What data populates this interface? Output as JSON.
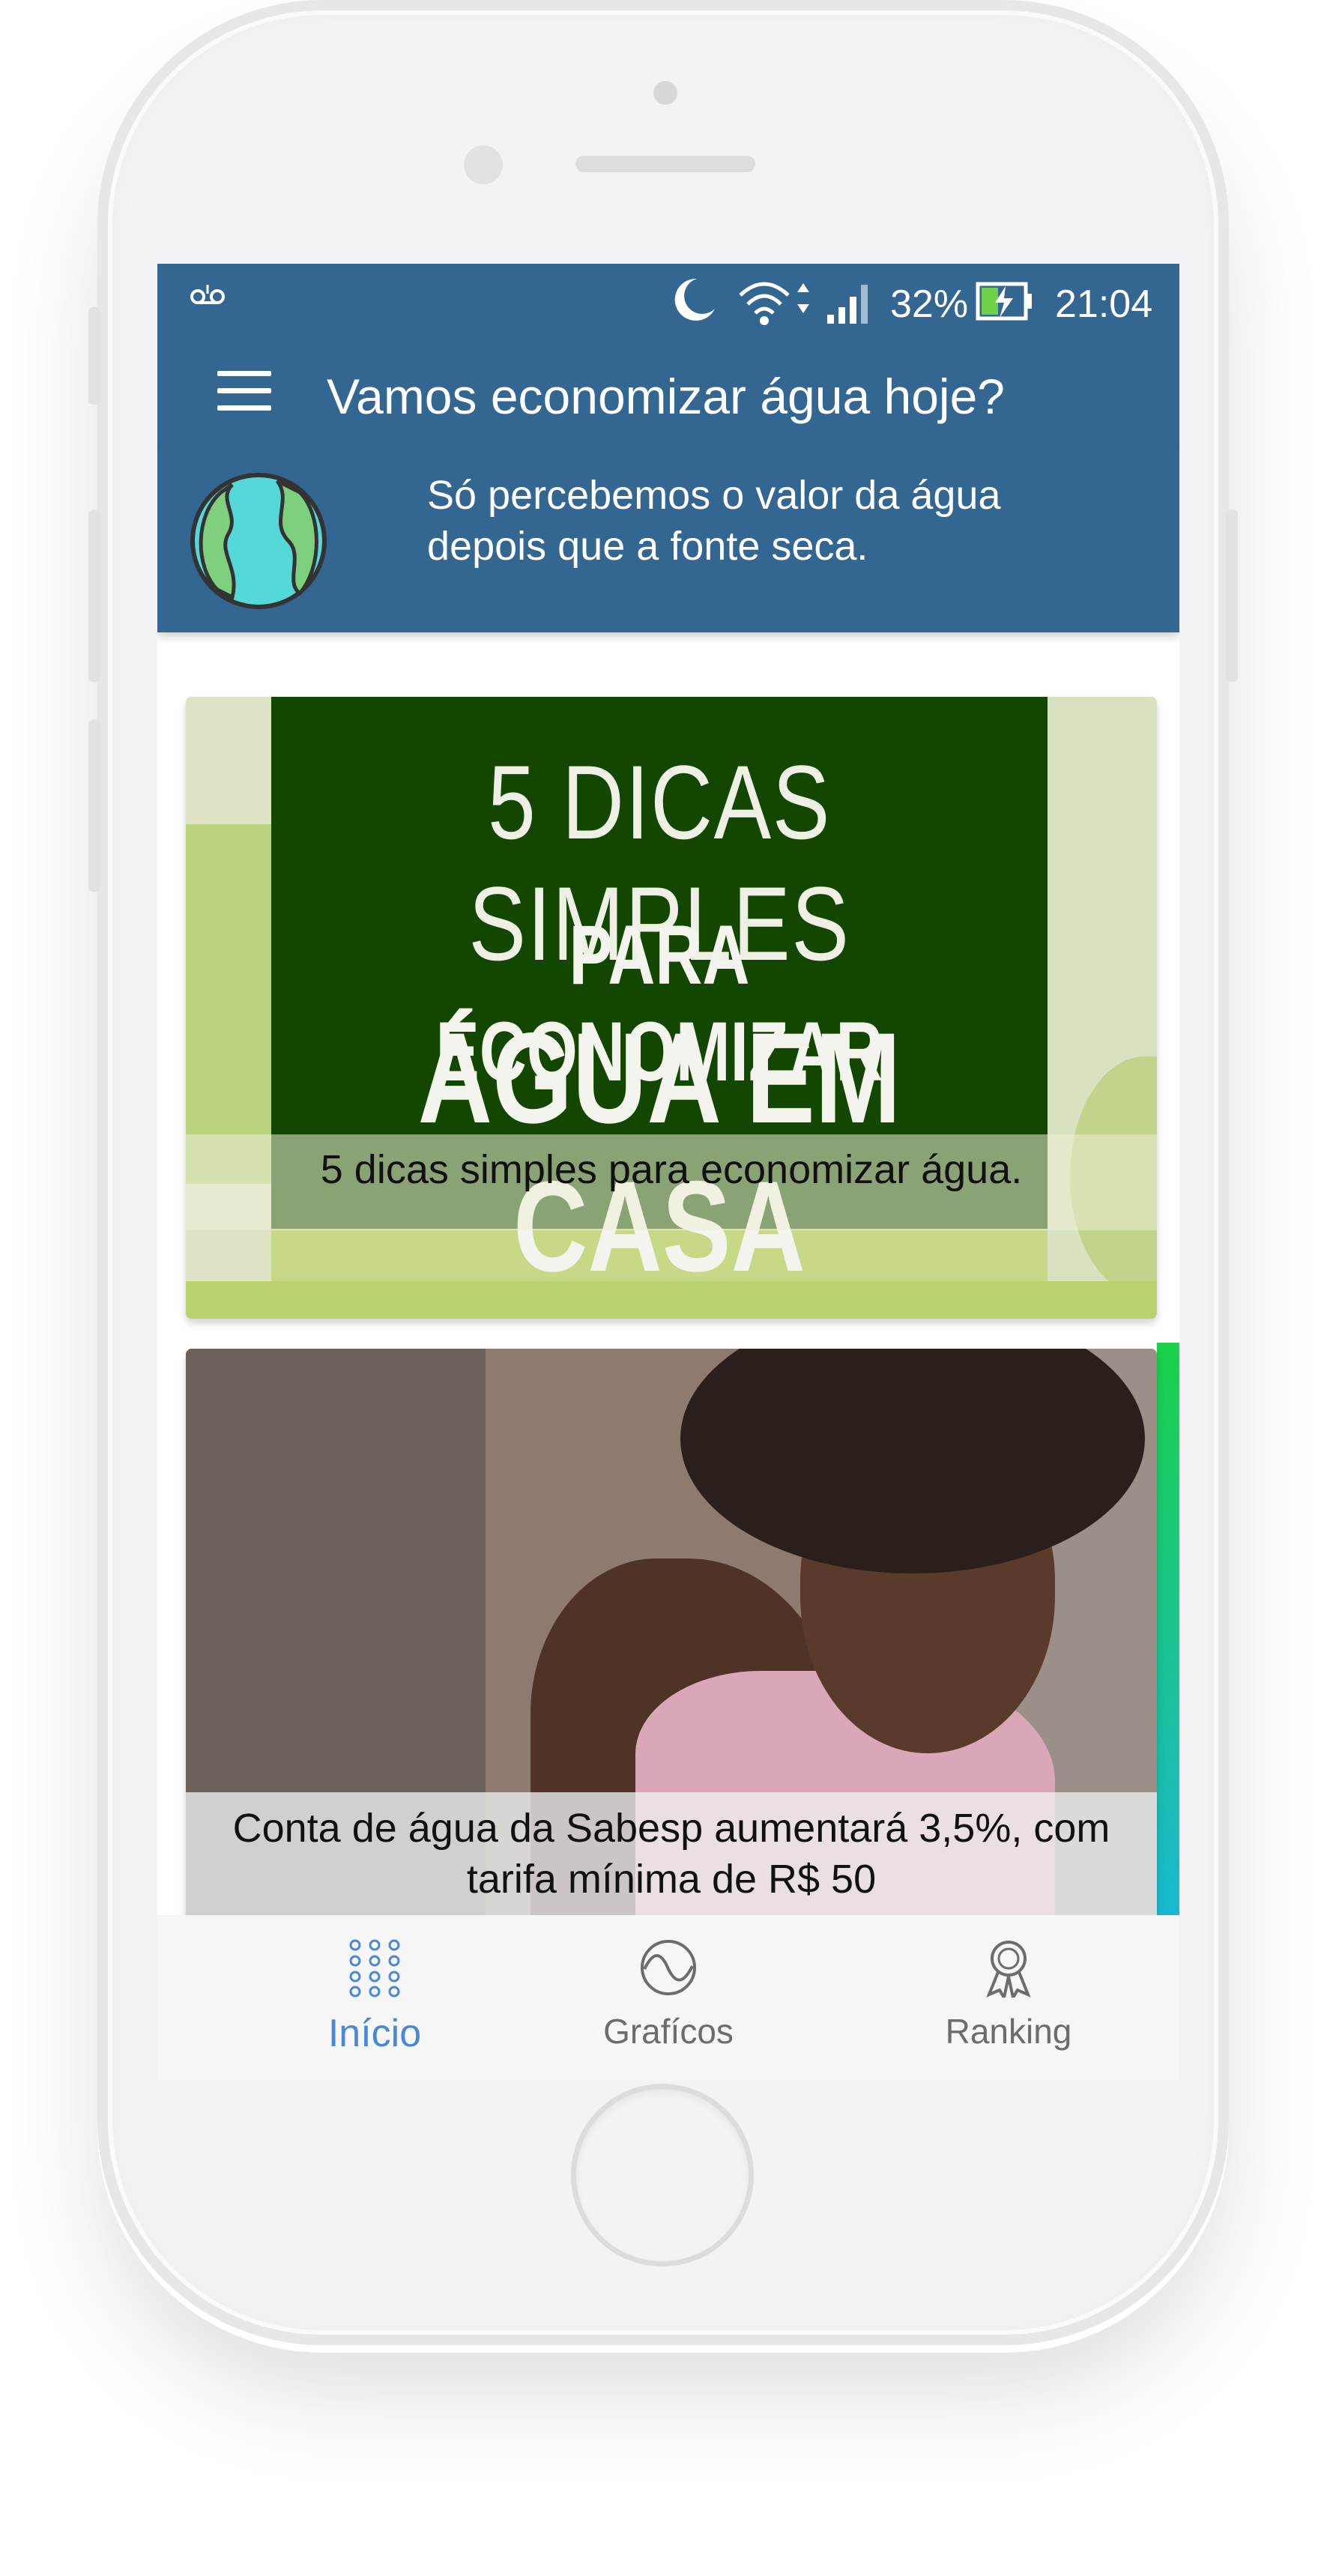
{
  "status_bar": {
    "voicemail_icon": "voicemail-icon",
    "battery_percent": "32%",
    "time": "21:04"
  },
  "app_bar": {
    "title": "Vamos economizar água hoje?"
  },
  "quote": {
    "text": "Só percebemos o valor da água depois que a fonte seca."
  },
  "cards": [
    {
      "image_heading_1": "5 DICAS SIMPLES",
      "image_heading_2": "PARA ECONOMIZAR",
      "image_heading_3": "ÁGUA EM CASA",
      "caption": "5 dicas simples para economizar água."
    },
    {
      "caption": "Conta de água da Sabesp aumentará 3,5%, com tarifa mínima de R$ 50"
    }
  ],
  "bottom_nav": {
    "items": [
      {
        "label": "Início",
        "icon": "grid-dots-icon",
        "active": true
      },
      {
        "label": "Grafícos",
        "icon": "wave-circle-icon",
        "active": false
      },
      {
        "label": "Ranking",
        "icon": "award-ribbon-icon",
        "active": false
      }
    ]
  },
  "colors": {
    "primary": "#336792",
    "active_nav": "#4a88d6",
    "inactive_nav": "#6c6c6c"
  }
}
